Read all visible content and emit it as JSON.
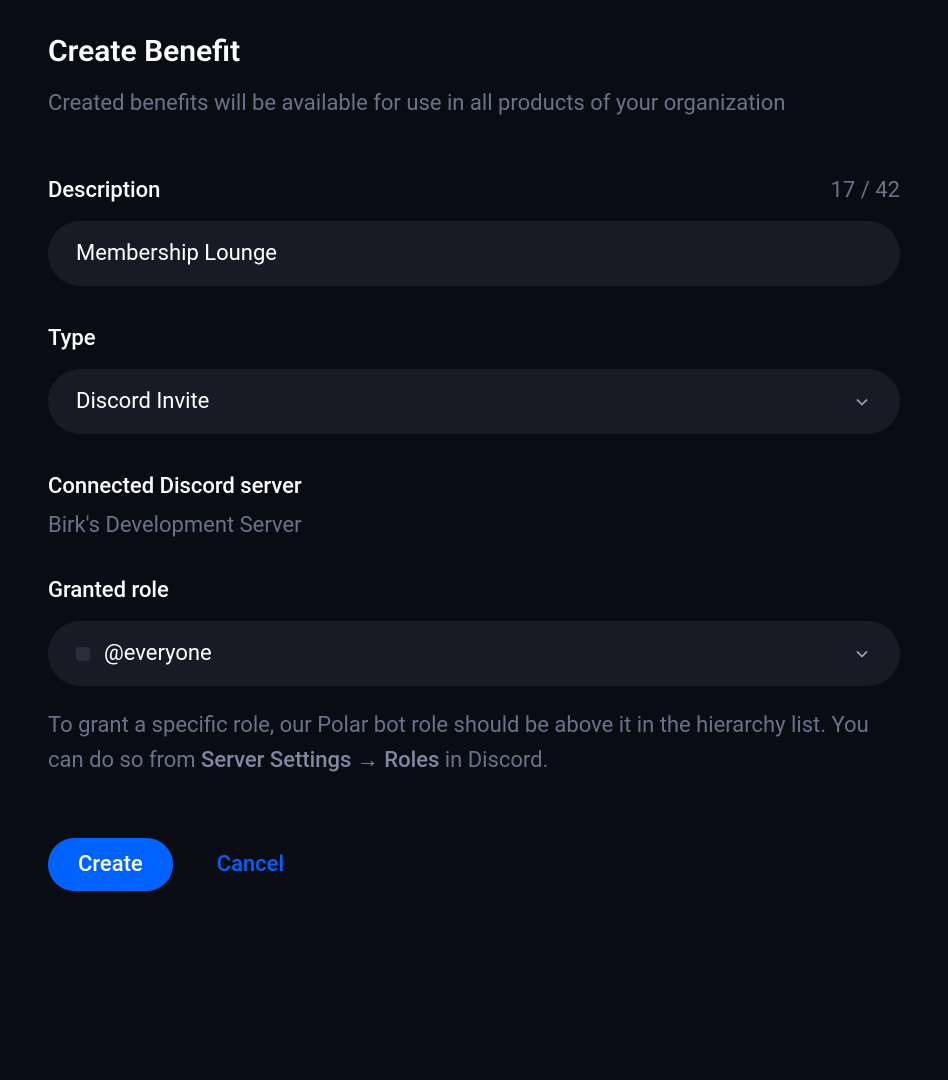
{
  "header": {
    "title": "Create Benefit",
    "subtitle": "Created benefits will be available for use in all products of your organization"
  },
  "description": {
    "label": "Description",
    "value": "Membership Lounge",
    "char_count": "17 / 42"
  },
  "type": {
    "label": "Type",
    "selected": "Discord Invite"
  },
  "connected_server": {
    "label": "Connected Discord server",
    "name": "Birk's Development Server"
  },
  "granted_role": {
    "label": "Granted role",
    "selected": "@everyone",
    "help_text_1": "To grant a specific role, our Polar bot role should be above it in the hierarchy list. You can do so from ",
    "help_text_bold": "Server Settings → Roles",
    "help_text_2": " in Discord."
  },
  "buttons": {
    "create": "Create",
    "cancel": "Cancel"
  }
}
